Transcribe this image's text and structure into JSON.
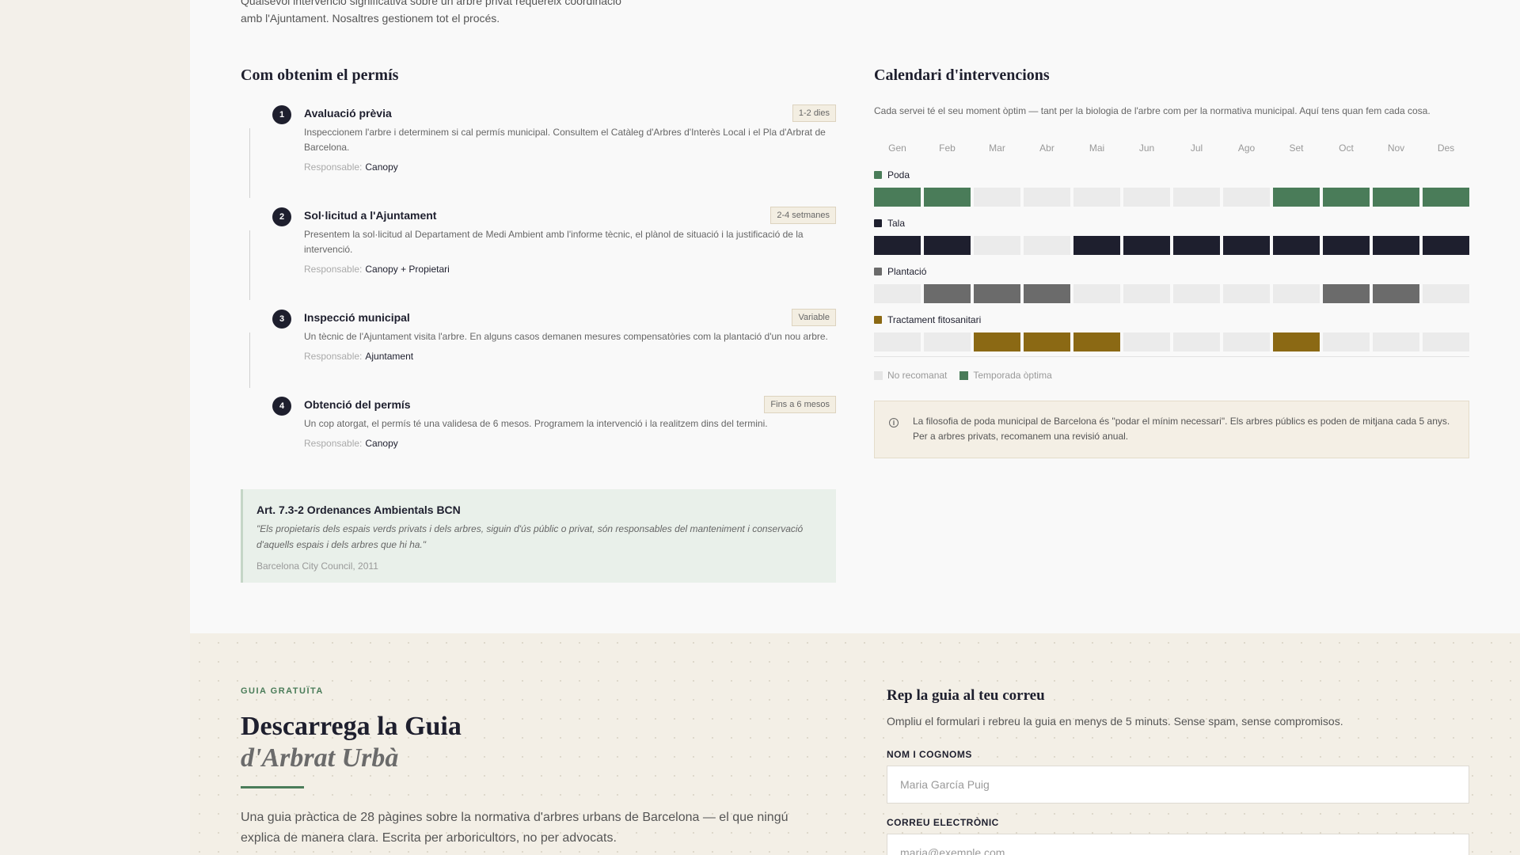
{
  "intro": {
    "line1": "Qualsevol intervenció significativa sobre un arbre privat requereix coordinació",
    "line2": "amb l'Ajuntament. Nosaltres gestionem tot el procés."
  },
  "steps_section": {
    "title": "Com obtenim el permís",
    "responsible_label": "Responsable:",
    "steps": [
      {
        "num": "1",
        "title": "Avaluació prèvia",
        "badge": "1-2 dies",
        "desc": "Inspeccionem l'arbre i determinem si cal permís municipal. Consultem el Catàleg d'Arbres d'Interès Local i el Pla d'Arbrat de Barcelona.",
        "resp": "Canopy"
      },
      {
        "num": "2",
        "title": "Sol·licitud a l'Ajuntament",
        "badge": "2-4 setmanes",
        "desc": "Presentem la sol·licitud al Departament de Medi Ambient amb l'informe tècnic, el plànol de situació i la justificació de la intervenció.",
        "resp": "Canopy + Propietari"
      },
      {
        "num": "3",
        "title": "Inspecció municipal",
        "badge": "Variable",
        "desc": "Un tècnic de l'Ajuntament visita l'arbre. En alguns casos demanen mesures compensatòries com la plantació d'un nou arbre.",
        "resp": "Ajuntament"
      },
      {
        "num": "4",
        "title": "Obtenció del permís",
        "badge": "Fins a 6 mesos",
        "desc": "Un cop atorgat, el permís té una validesa de 6 mesos. Programem la intervenció i la realitzem dins del termini.",
        "resp": "Canopy"
      }
    ]
  },
  "ordinance": {
    "title": "Art. 7.3-2 Ordenances Ambientals BCN",
    "quote": "\"Els propietaris dels espais verds privats i dels arbres, siguin d'ús públic o privat, són responsables del manteniment i conservació d'aquells espais i dels arbres que hi ha.\"",
    "source": "Barcelona City Council, 2011"
  },
  "calendar": {
    "title": "Calendari d'intervencions",
    "description": "Cada servei té el seu moment òptim — tant per la biologia de l'arbre com per la normativa municipal. Aquí tens quan fem cada cosa.",
    "months": [
      "Gen",
      "Feb",
      "Mar",
      "Abr",
      "Mai",
      "Jun",
      "Jul",
      "Ago",
      "Set",
      "Oct",
      "Nov",
      "Des"
    ],
    "inactive_color": "#ebebeb",
    "services": [
      {
        "name": "Poda",
        "color": "#4a7c59",
        "active": [
          1,
          1,
          0,
          0,
          0,
          0,
          0,
          0,
          1,
          1,
          1,
          1
        ]
      },
      {
        "name": "Tala",
        "color": "#1e1f2e",
        "active": [
          1,
          1,
          0,
          0,
          1,
          1,
          1,
          1,
          1,
          1,
          1,
          1
        ]
      },
      {
        "name": "Plantació",
        "color": "#6b6b6b",
        "active": [
          0,
          1,
          1,
          1,
          0,
          0,
          0,
          0,
          0,
          1,
          1,
          0
        ]
      },
      {
        "name": "Tractament fitosanitari",
        "color": "#8b6914",
        "active": [
          0,
          0,
          1,
          1,
          1,
          0,
          0,
          0,
          1,
          0,
          0,
          0
        ]
      }
    ],
    "legend": {
      "not_recommended": "No recomanat",
      "optimal": "Temporada òptima",
      "optimal_color": "#4a7c59"
    },
    "info": "La filosofia de poda municipal de Barcelona és \"podar el mínim necessari\". Els arbres públics es poden de mitjana cada 5 anys. Per a arbres privats, recomanem una revisió anual."
  },
  "guide": {
    "eyebrow": "GUIA GRATUÏTA",
    "title_line1": "Descarrega la Guia",
    "title_line2": "d'Arbrat Urbà",
    "description": "Una guia pràctica de 28 pàgines sobre la normativa d'arbres urbans de Barcelona — el que ningú explica de manera clara. Escrita per arboricultors, no per advocats."
  },
  "form": {
    "title": "Rep la guia al teu correu",
    "subtitle": "Ompliu el formulari i rebreu la guia en menys de 5 minuts. Sense spam, sense compromisos.",
    "name_label": "NOM I COGNOMS",
    "name_placeholder": "Maria García Puig",
    "email_label": "CORREU ELECTRÒNIC",
    "email_placeholder": "maria@exemple.com"
  }
}
